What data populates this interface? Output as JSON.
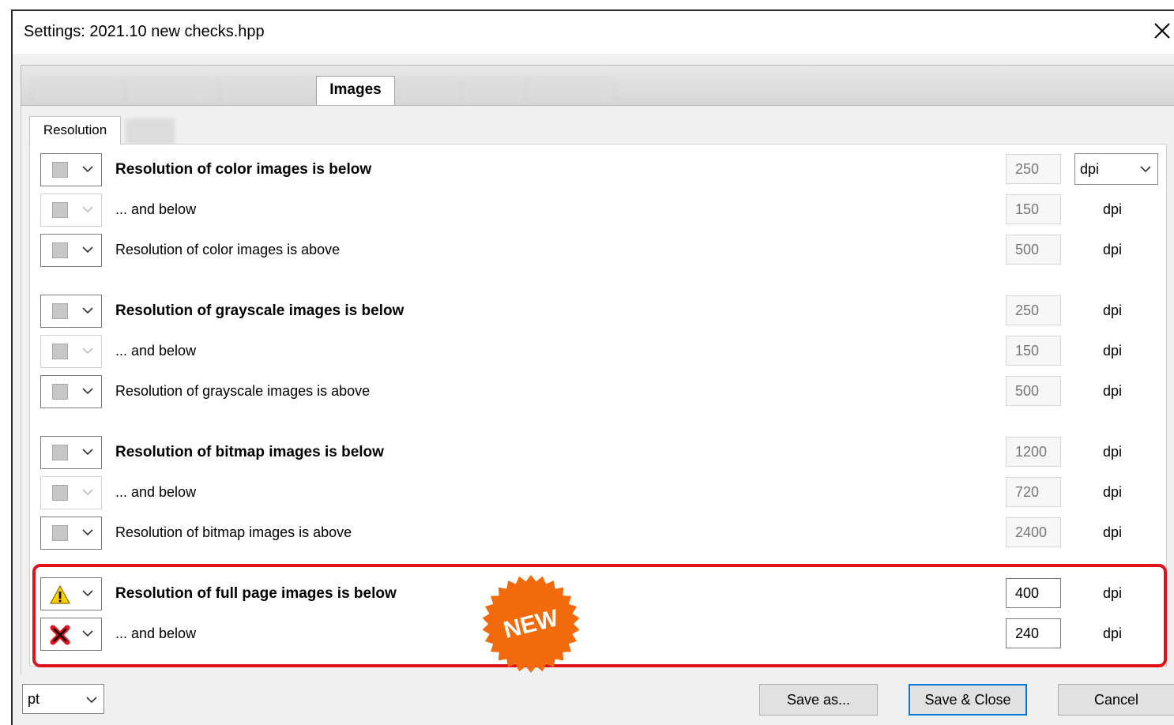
{
  "window": {
    "title": "Settings:  2021.10 new checks.hpp"
  },
  "outer_tabs": {
    "active_label": "Images"
  },
  "inner_tabs": {
    "active_label": "Resolution"
  },
  "rows": [
    {
      "label": "Resolution of color images is below",
      "bold": true,
      "value": "250",
      "unit": "dpi",
      "status": "gray"
    },
    {
      "label": "... and below",
      "bold": false,
      "value": "150",
      "unit": "dpi",
      "status": "gray"
    },
    {
      "label": "Resolution of color images is above",
      "bold": false,
      "value": "500",
      "unit": "dpi",
      "status": "gray"
    },
    {
      "label": "Resolution of grayscale images is below",
      "bold": true,
      "value": "250",
      "unit": "dpi",
      "status": "gray"
    },
    {
      "label": "... and below",
      "bold": false,
      "value": "150",
      "unit": "dpi",
      "status": "gray"
    },
    {
      "label": "Resolution of grayscale images is above",
      "bold": false,
      "value": "500",
      "unit": "dpi",
      "status": "gray"
    },
    {
      "label": "Resolution of bitmap images is below",
      "bold": true,
      "value": "1200",
      "unit": "dpi",
      "status": "gray"
    },
    {
      "label": "... and below",
      "bold": false,
      "value": "720",
      "unit": "dpi",
      "status": "gray"
    },
    {
      "label": "Resolution of bitmap images is above",
      "bold": false,
      "value": "2400",
      "unit": "dpi",
      "status": "gray"
    },
    {
      "label": "Resolution of full page images is below",
      "bold": true,
      "value": "400",
      "unit": "dpi",
      "status": "warning"
    },
    {
      "label": "... and below",
      "bold": false,
      "value": "240",
      "unit": "dpi",
      "status": "error"
    }
  ],
  "unit_select": {
    "value": "dpi"
  },
  "badge": {
    "text": "NEW",
    "color": "#f26a0c"
  },
  "highlight_color": "#e0121a",
  "footer": {
    "unit_select": "pt",
    "save_as": "Save as...",
    "save_close": "Save & Close",
    "cancel": "Cancel"
  }
}
